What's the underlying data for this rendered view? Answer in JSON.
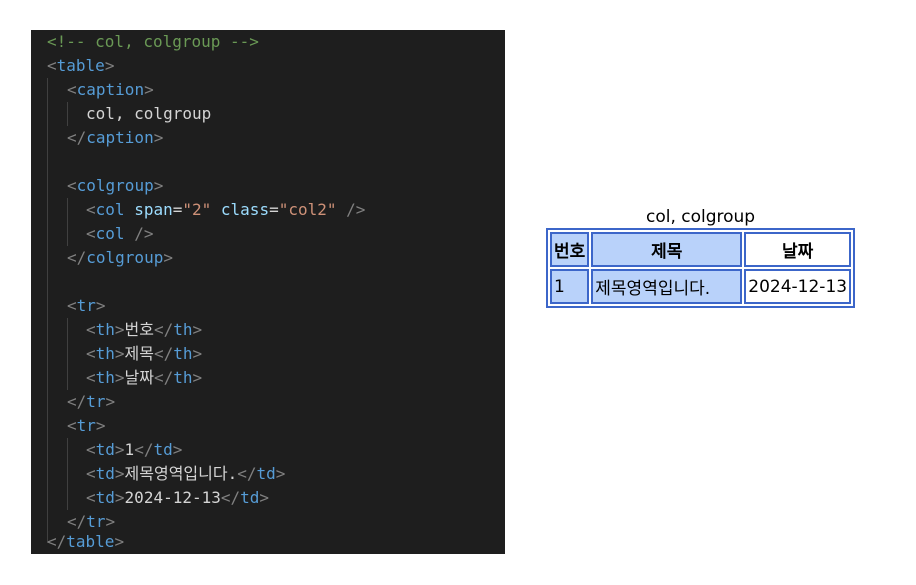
{
  "code": {
    "comment": "<!-- col, colgroup -->",
    "table_tag": "table",
    "caption_tag": "caption",
    "caption_text": "col, colgroup",
    "colgroup_tag": "colgroup",
    "col_tag": "col",
    "span_attr": "span",
    "span_value": "\"2\"",
    "class_attr": "class",
    "class_value": "\"col2\"",
    "tr_tag": "tr",
    "th_tag": "th",
    "td_tag": "td",
    "th1": "번호",
    "th2": "제목",
    "th3": "날짜",
    "td1": "1",
    "td2": "제목영역입니다.",
    "td3": "2024-12-13"
  },
  "preview": {
    "caption": "col, colgroup",
    "headers": [
      "번호",
      "제목",
      "날짜"
    ],
    "row": [
      "1",
      "제목영역입니다.",
      "2024-12-13"
    ]
  },
  "colors": {
    "editor_bg": "#1e1e1e",
    "table_border": "#3c66c9",
    "col_highlight": "#b9d2fa"
  }
}
